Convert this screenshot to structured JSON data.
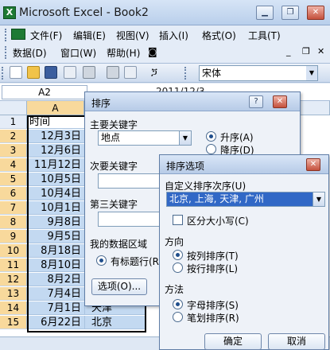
{
  "window": {
    "title": "Microsoft Excel - Book2"
  },
  "menus": {
    "row1": [
      "文件(F)",
      "编辑(E)",
      "视图(V)",
      "插入(I)",
      "格式(O)",
      "工具(T)"
    ],
    "row2": [
      "数据(D)",
      "窗口(W)",
      "帮助(H)"
    ]
  },
  "toolbar": {
    "font": "宋体"
  },
  "formula": {
    "namebox": "A2",
    "value": "2011/12/3"
  },
  "grid": {
    "col_a": "A",
    "rows": [
      {
        "n": "1",
        "a": "时间",
        "b": ""
      },
      {
        "n": "2",
        "a": "12月3日",
        "b": ""
      },
      {
        "n": "3",
        "a": "12月6日",
        "b": ""
      },
      {
        "n": "4",
        "a": "11月12日",
        "b": ""
      },
      {
        "n": "5",
        "a": "10月5日",
        "b": ""
      },
      {
        "n": "6",
        "a": "10月4日",
        "b": ""
      },
      {
        "n": "7",
        "a": "10月1日",
        "b": ""
      },
      {
        "n": "8",
        "a": "9月8日",
        "b": ""
      },
      {
        "n": "9",
        "a": "9月5日",
        "b": ""
      },
      {
        "n": "10",
        "a": "8月18日",
        "b": ""
      },
      {
        "n": "11",
        "a": "8月10日",
        "b": ""
      },
      {
        "n": "12",
        "a": "8月2日",
        "b": ""
      },
      {
        "n": "13",
        "a": "7月4日",
        "b": "北京"
      },
      {
        "n": "14",
        "a": "7月1日",
        "b": "天津"
      },
      {
        "n": "15",
        "a": "6月22日",
        "b": "北京"
      }
    ]
  },
  "sort_dialog": {
    "title": "排序",
    "primary_label": "主要关键字",
    "primary_value": "地点",
    "asc": "升序(A)",
    "desc": "降序(D)",
    "secondary_label": "次要关键字",
    "tertiary_label": "第三关键字",
    "range_label": "我的数据区域",
    "header_row": "有标题行(R)",
    "options_btn": "选项(O)..."
  },
  "options_dialog": {
    "title": "排序选项",
    "custom_order_label": "自定义排序次序(U)",
    "custom_order_value": "北京, 上海, 天津, 广州",
    "case_sensitive": "区分大小写(C)",
    "direction_label": "方向",
    "by_column": "按列排序(T)",
    "by_row": "按行排序(L)",
    "method_label": "方法",
    "by_letter": "字母排序(S)",
    "by_stroke": "笔划排序(R)",
    "ok": "确定",
    "cancel": "取消"
  }
}
